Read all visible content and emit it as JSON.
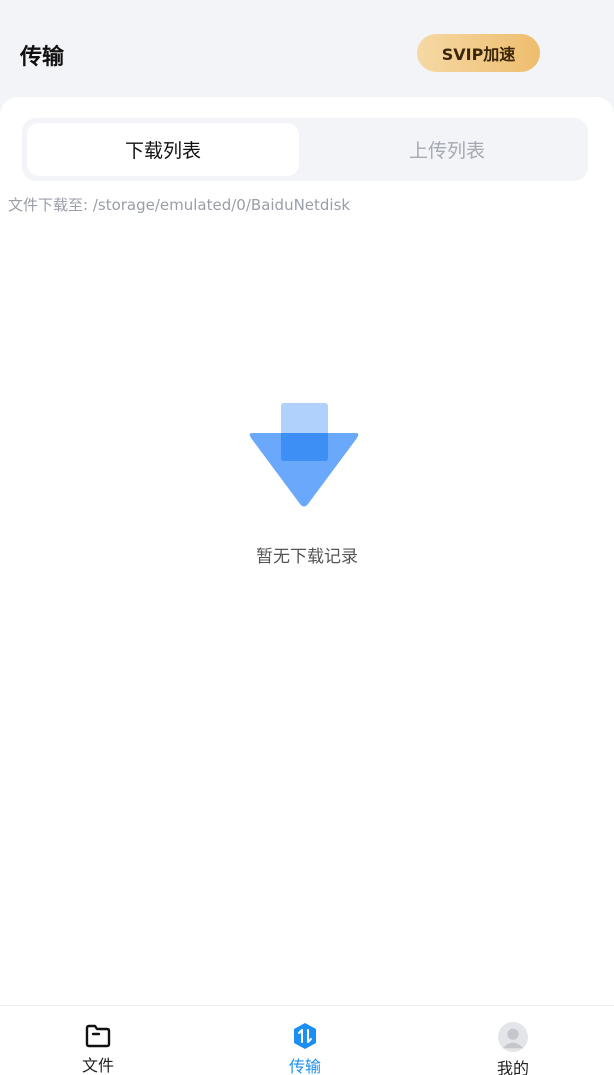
{
  "header": {
    "title": "传输",
    "svip_label": "SVIP加速"
  },
  "tabs": [
    {
      "label": "下载列表",
      "active": true
    },
    {
      "label": "上传列表",
      "active": false
    }
  ],
  "download_path": "文件下载至: /storage/emulated/0/BaiduNetdisk",
  "empty_state": {
    "message": "暂无下载记录",
    "icon": "download-arrow-icon"
  },
  "bottom_nav": [
    {
      "label": "文件",
      "icon": "folder-icon",
      "active": false
    },
    {
      "label": "传输",
      "icon": "transfer-icon",
      "active": true
    },
    {
      "label": "我的",
      "icon": "avatar-icon",
      "active": false
    }
  ],
  "colors": {
    "accent": "#1b8ff2",
    "svip_gradient_start": "#f5d9a4",
    "svip_gradient_end": "#eebd6e",
    "background": "#f3f4f8"
  }
}
